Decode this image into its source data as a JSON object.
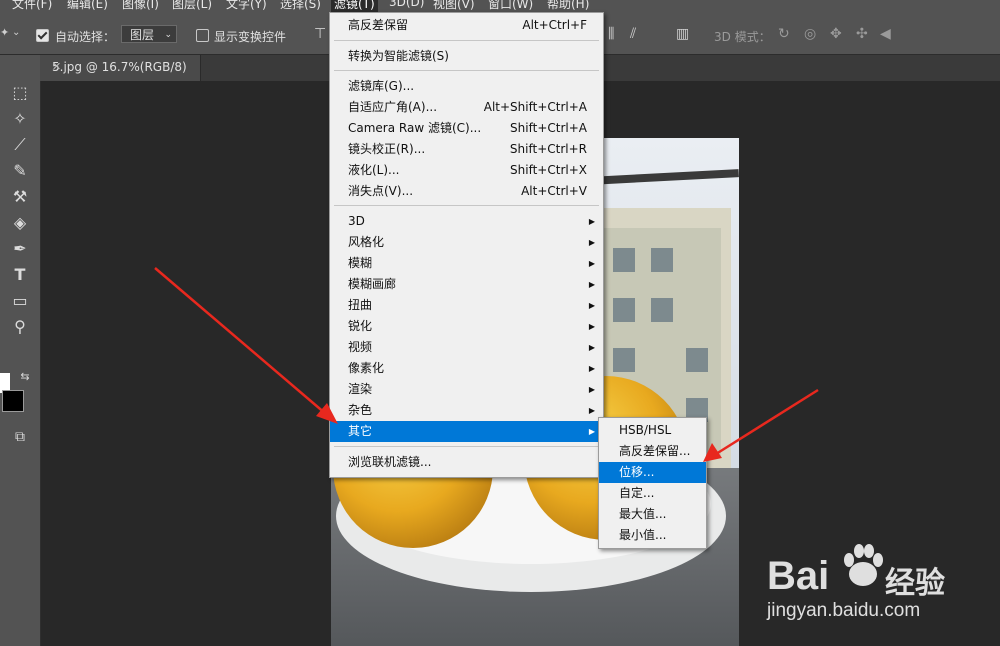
{
  "menubar": {
    "items": [
      "文件(F)",
      "编辑(E)",
      "图像(I)",
      "图层(L)",
      "文字(Y)",
      "选择(S)",
      "滤镜(T)",
      "3D(D)",
      "视图(V)",
      "窗口(W)",
      "帮助(H)"
    ],
    "active_index": 6
  },
  "options": {
    "auto_select_label": "自动选择：",
    "auto_select_checked": true,
    "layer_dropdown_value": "图层",
    "show_transform_label": "显示变换控件",
    "show_transform_checked": false,
    "mode_3d_label": "3D 模式："
  },
  "document": {
    "tab_title": "5.jpg @ 16.7%(RGB/8)"
  },
  "filter_menu": {
    "items": [
      {
        "label": "高反差保留",
        "shortcut": "Alt+Ctrl+F"
      },
      {
        "label": "转换为智能滤镜(S)",
        "shortcut": ""
      },
      {
        "label": "滤镜库(G)...",
        "shortcut": ""
      },
      {
        "label": "自适应广角(A)...",
        "shortcut": "Alt+Shift+Ctrl+A"
      },
      {
        "label": "Camera Raw 滤镜(C)...",
        "shortcut": "Shift+Ctrl+A"
      },
      {
        "label": "镜头校正(R)...",
        "shortcut": "Shift+Ctrl+R"
      },
      {
        "label": "液化(L)...",
        "shortcut": "Shift+Ctrl+X"
      },
      {
        "label": "消失点(V)...",
        "shortcut": "Alt+Ctrl+V"
      },
      {
        "label": "3D",
        "shortcut": ""
      },
      {
        "label": "风格化",
        "shortcut": ""
      },
      {
        "label": "模糊",
        "shortcut": ""
      },
      {
        "label": "模糊画廊",
        "shortcut": ""
      },
      {
        "label": "扭曲",
        "shortcut": ""
      },
      {
        "label": "锐化",
        "shortcut": ""
      },
      {
        "label": "视频",
        "shortcut": ""
      },
      {
        "label": "像素化",
        "shortcut": ""
      },
      {
        "label": "渲染",
        "shortcut": ""
      },
      {
        "label": "杂色",
        "shortcut": ""
      },
      {
        "label": "其它",
        "shortcut": ""
      },
      {
        "label": "浏览联机滤镜...",
        "shortcut": ""
      }
    ],
    "highlighted": "其它"
  },
  "other_submenu": {
    "items": [
      "HSB/HSL",
      "高反差保留...",
      "位移...",
      "自定...",
      "最大值...",
      "最小值..."
    ],
    "highlighted": "位移..."
  },
  "watermark": {
    "brand": "Bai",
    "brand_suffix": "经验",
    "url": "jingyan.baidu.com"
  },
  "colors": {
    "highlight": "#0078d7",
    "annotation_arrow": "#e8281e",
    "panel_bg": "#535353",
    "workspace_bg": "#282828"
  }
}
